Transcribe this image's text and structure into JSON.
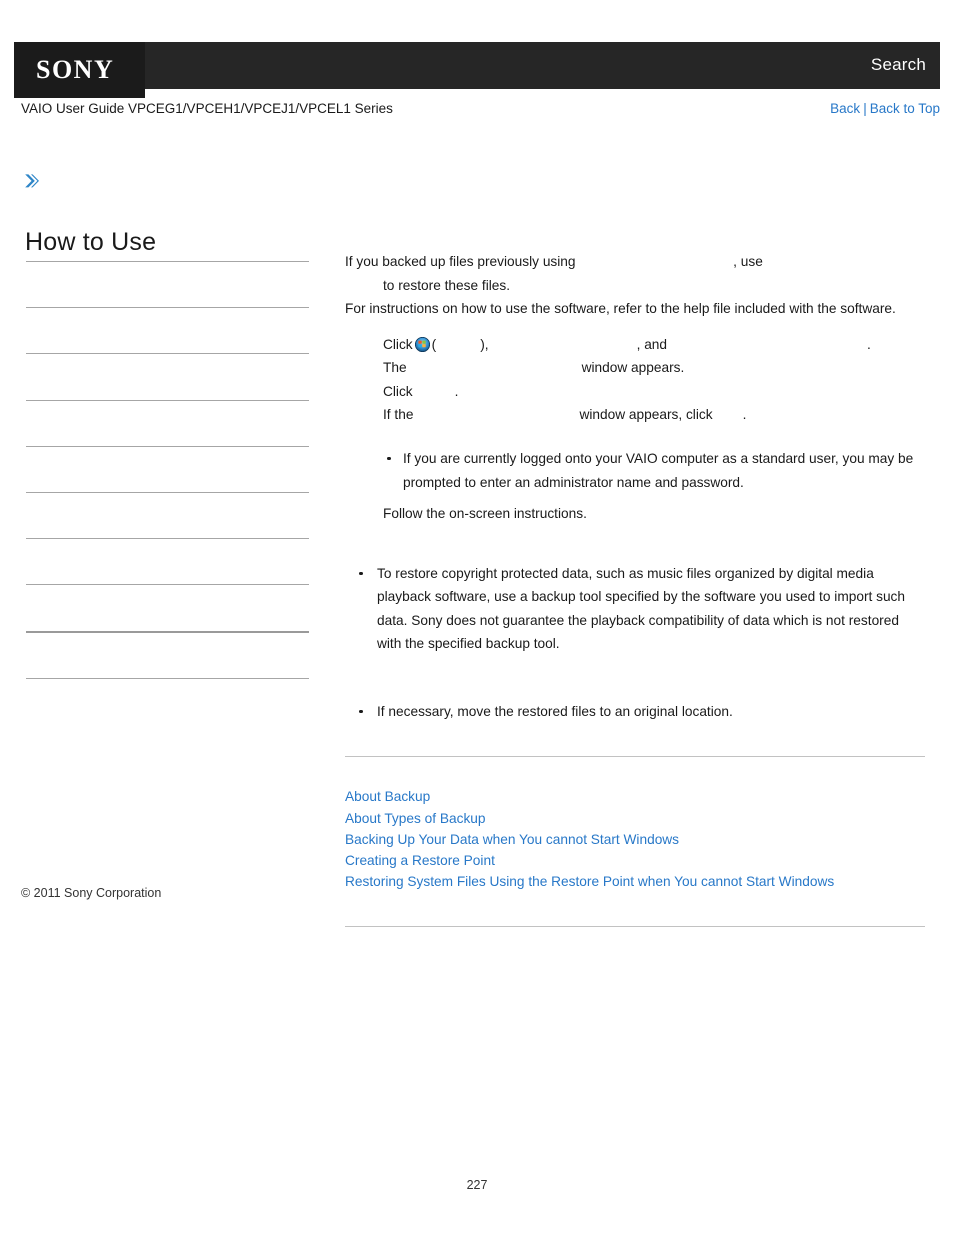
{
  "header": {
    "logo_text": "SONY",
    "search_label": "Search",
    "logo_bg": "#1b1b1b",
    "bar_bg": "#262626"
  },
  "subheader": {
    "guide_title": "VAIO User Guide VPCEG1/VPCEH1/VPCEJ1/VPCEL1 Series",
    "back_label": "Back",
    "separator": "|",
    "back_to_top_label": "Back to Top",
    "link_color": "#2878c8"
  },
  "sidebar": {
    "expand_icon": "chevron-right-icon",
    "title": "How to Use",
    "items": [
      {
        "label": ""
      },
      {
        "label": ""
      },
      {
        "label": ""
      },
      {
        "label": ""
      },
      {
        "label": ""
      },
      {
        "label": ""
      },
      {
        "label": ""
      },
      {
        "label": ""
      },
      {
        "label": ""
      },
      {
        "label": ""
      }
    ]
  },
  "content": {
    "intro_line_1_a": "If you backed up files previously using",
    "intro_line_1_term": "",
    "intro_line_1_b": ", use",
    "intro_line_2_term": "",
    "intro_line_2_b": "to restore these files.",
    "intro_line_3": "For instructions on how to use the software, refer to the help file included with the software.",
    "step_1_click": "Click",
    "step_1_orb": "windows-start-orb-icon",
    "step_1_paren_open": "(",
    "step_1_start_term": "",
    "step_1_paren_close": "),",
    "step_1_mid_term": "",
    "step_1_and": ", and",
    "step_1_end_term": "",
    "step_1_period": ".",
    "step_2_the": "The",
    "step_2_term": "",
    "step_2_tail": "window appears.",
    "step_3_click": "Click",
    "step_3_term": "",
    "step_3_period": ".",
    "step_4_ifthe": "If the",
    "step_4_term": "",
    "step_4_mid": "window appears, click",
    "step_4_term2": "",
    "step_4_period": ".",
    "note_items": [
      "If you are currently logged onto your VAIO computer as a standard user, you may be prompted to enter an administrator name and password."
    ],
    "follow_line": "Follow the on-screen instructions.",
    "notice_items": [
      "To restore copyright protected data, such as music files organized by digital media playback software, use a backup tool specified by the software you used to import such data. Sony does not guarantee the playback compatibility of data which is not restored with the specified backup tool.",
      "If necessary, move the restored files to an original location."
    ]
  },
  "related": {
    "links": [
      "About Backup",
      "About Types of Backup",
      "Backing Up Your Data when You cannot Start Windows",
      "Creating a Restore Point",
      "Restoring System Files Using the Restore Point when You cannot Start Windows"
    ]
  },
  "footer": {
    "copyright": "© 2011 Sony Corporation",
    "page_number": "227"
  }
}
